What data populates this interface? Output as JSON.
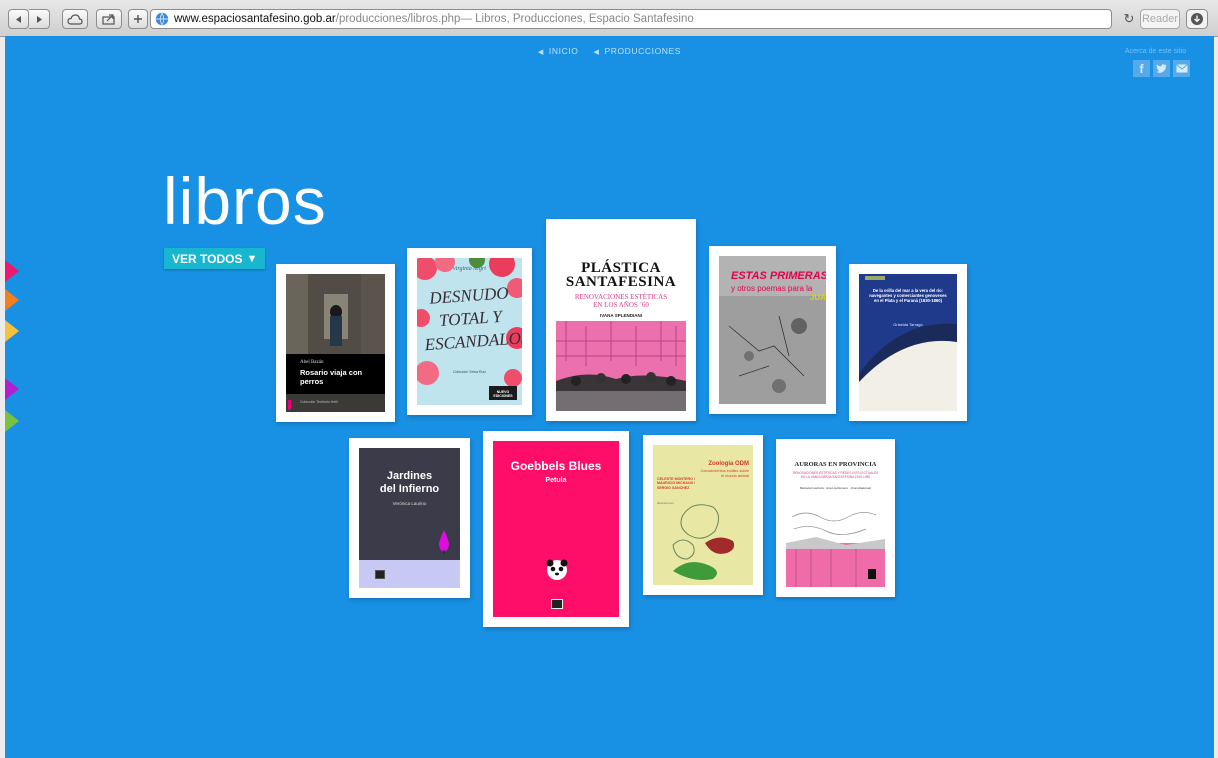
{
  "browser": {
    "url_host": "www.espaciosantafesino.gob.ar",
    "url_path": "/producciones/libros.php",
    "page_title": " — Libros, Producciones, Espacio Santafesino",
    "reader_label": "Reader"
  },
  "nav": {
    "inicio": "INICIO",
    "producciones": "PRODUCCIONES"
  },
  "about": "Acerca de este sitio",
  "social": {
    "facebook": "f",
    "twitter": "t",
    "mail": "✉"
  },
  "heading": "libros",
  "ver_todos": "VER TODOS",
  "ver_todos_arrow": "▼",
  "side_colors": [
    "#e91a70",
    "#f57f1f",
    "#f7c23b",
    "#b21ed0",
    "#7ac142"
  ],
  "books": [
    {
      "id": "rosario",
      "author": "Abel Bazán",
      "title": "Rosario viaja con perros",
      "footer": "Colección Territorio fértil"
    },
    {
      "id": "desnudo",
      "author": "virginia negri",
      "title": "DESNUDO TOTAL Y ESCANDALOSO",
      "subtitle": "Colección Selva Ruiz",
      "footer": "NUEVO EDICIONES"
    },
    {
      "id": "plastica",
      "title_line1": "PLÁSTICA",
      "title_line2": "SANTAFESINA",
      "subtitle_line1": "RENOVACIONES ESTÉTICAS",
      "subtitle_line2": "EN LOS AÑOS ´60",
      "author": "IVANA SPLENDIANI"
    },
    {
      "id": "estas",
      "title": "ESTAS PRIMERAS",
      "subtitle": "y otros poemas para la",
      "author": "JUA"
    },
    {
      "id": "orilla",
      "title": "De la orilla del mar a la vera del río: navegantes y comerciantes genoveses en el Plata y el Paraná (1830-1860)",
      "author": "Griselda Tarragó"
    },
    {
      "id": "jardines",
      "title_line1": "Jardines",
      "title_line2": "del Infierno",
      "author": "Verónica Laurino"
    },
    {
      "id": "goebbels",
      "title": "Goebbels Blues",
      "author": "Petula"
    },
    {
      "id": "zoologia",
      "title": "Zoología ODM",
      "subtitle": "Conocimientos inútiles sobre el mundo animal",
      "authors": "CELESTE MONTERO / MAURICIO MICHAUD / SERGIO SÁNCHEZ",
      "credits": "Ilustraciones"
    },
    {
      "id": "auroras",
      "title": "AURORAS EN PROVINCIA",
      "subtitle": "RENOVACIONES ESTÉTICAS Y REDES INTELECTUALES EN LA VANGUARDIA SANTAFESINA 1920-1950",
      "author": "Marcela Inostroza · Ana Lía Romero · (Compiladoras)"
    }
  ]
}
